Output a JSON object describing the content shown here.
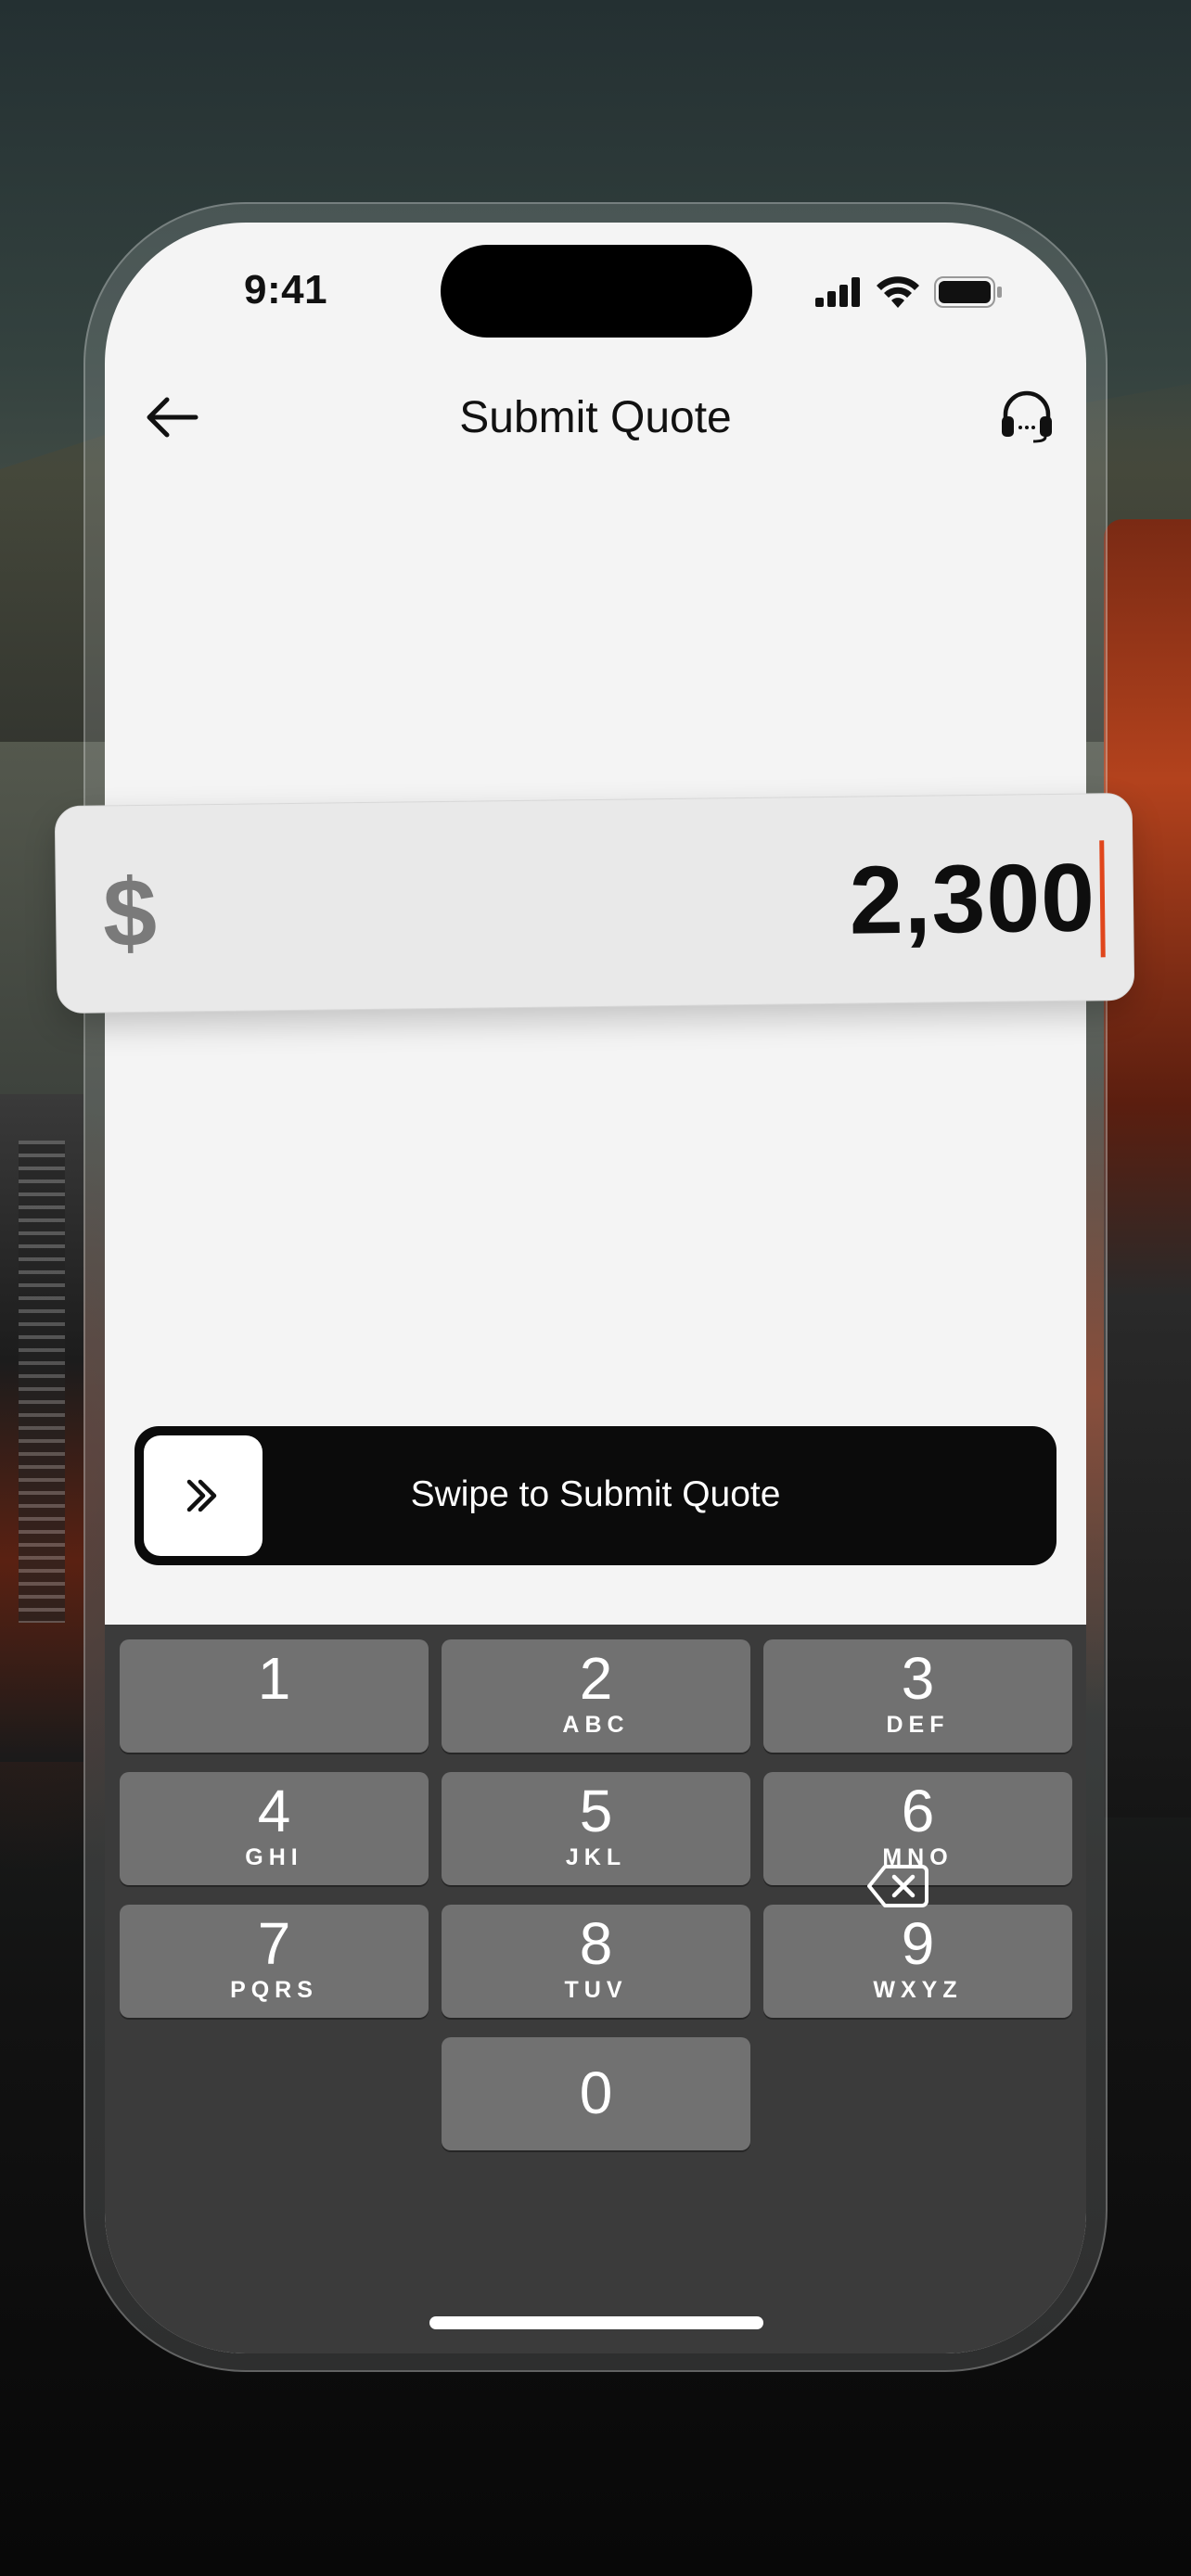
{
  "status_bar": {
    "time": "9:41"
  },
  "header": {
    "title": "Submit Quote"
  },
  "amount": {
    "currency_symbol": "$",
    "value": "2,300"
  },
  "swipe": {
    "label": "Swipe to Submit Quote"
  },
  "keypad": {
    "keys": [
      {
        "num": "1",
        "letters": ""
      },
      {
        "num": "2",
        "letters": "ABC"
      },
      {
        "num": "3",
        "letters": "DEF"
      },
      {
        "num": "4",
        "letters": "GHI"
      },
      {
        "num": "5",
        "letters": "JKL"
      },
      {
        "num": "6",
        "letters": "MNO"
      },
      {
        "num": "7",
        "letters": "PQRS"
      },
      {
        "num": "8",
        "letters": "TUV"
      },
      {
        "num": "9",
        "letters": "WXYZ"
      },
      {
        "num": "0",
        "letters": ""
      }
    ]
  },
  "colors": {
    "caret": "#e0461c",
    "swipe_bg": "#0b0b0b",
    "key_bg": "#717171",
    "keyboard_bg": "#3b3b3b"
  },
  "icons": {
    "back": "arrow-left-icon",
    "support": "headset-icon",
    "swipe": "double-chevron-right-icon",
    "delete": "backspace-icon"
  }
}
